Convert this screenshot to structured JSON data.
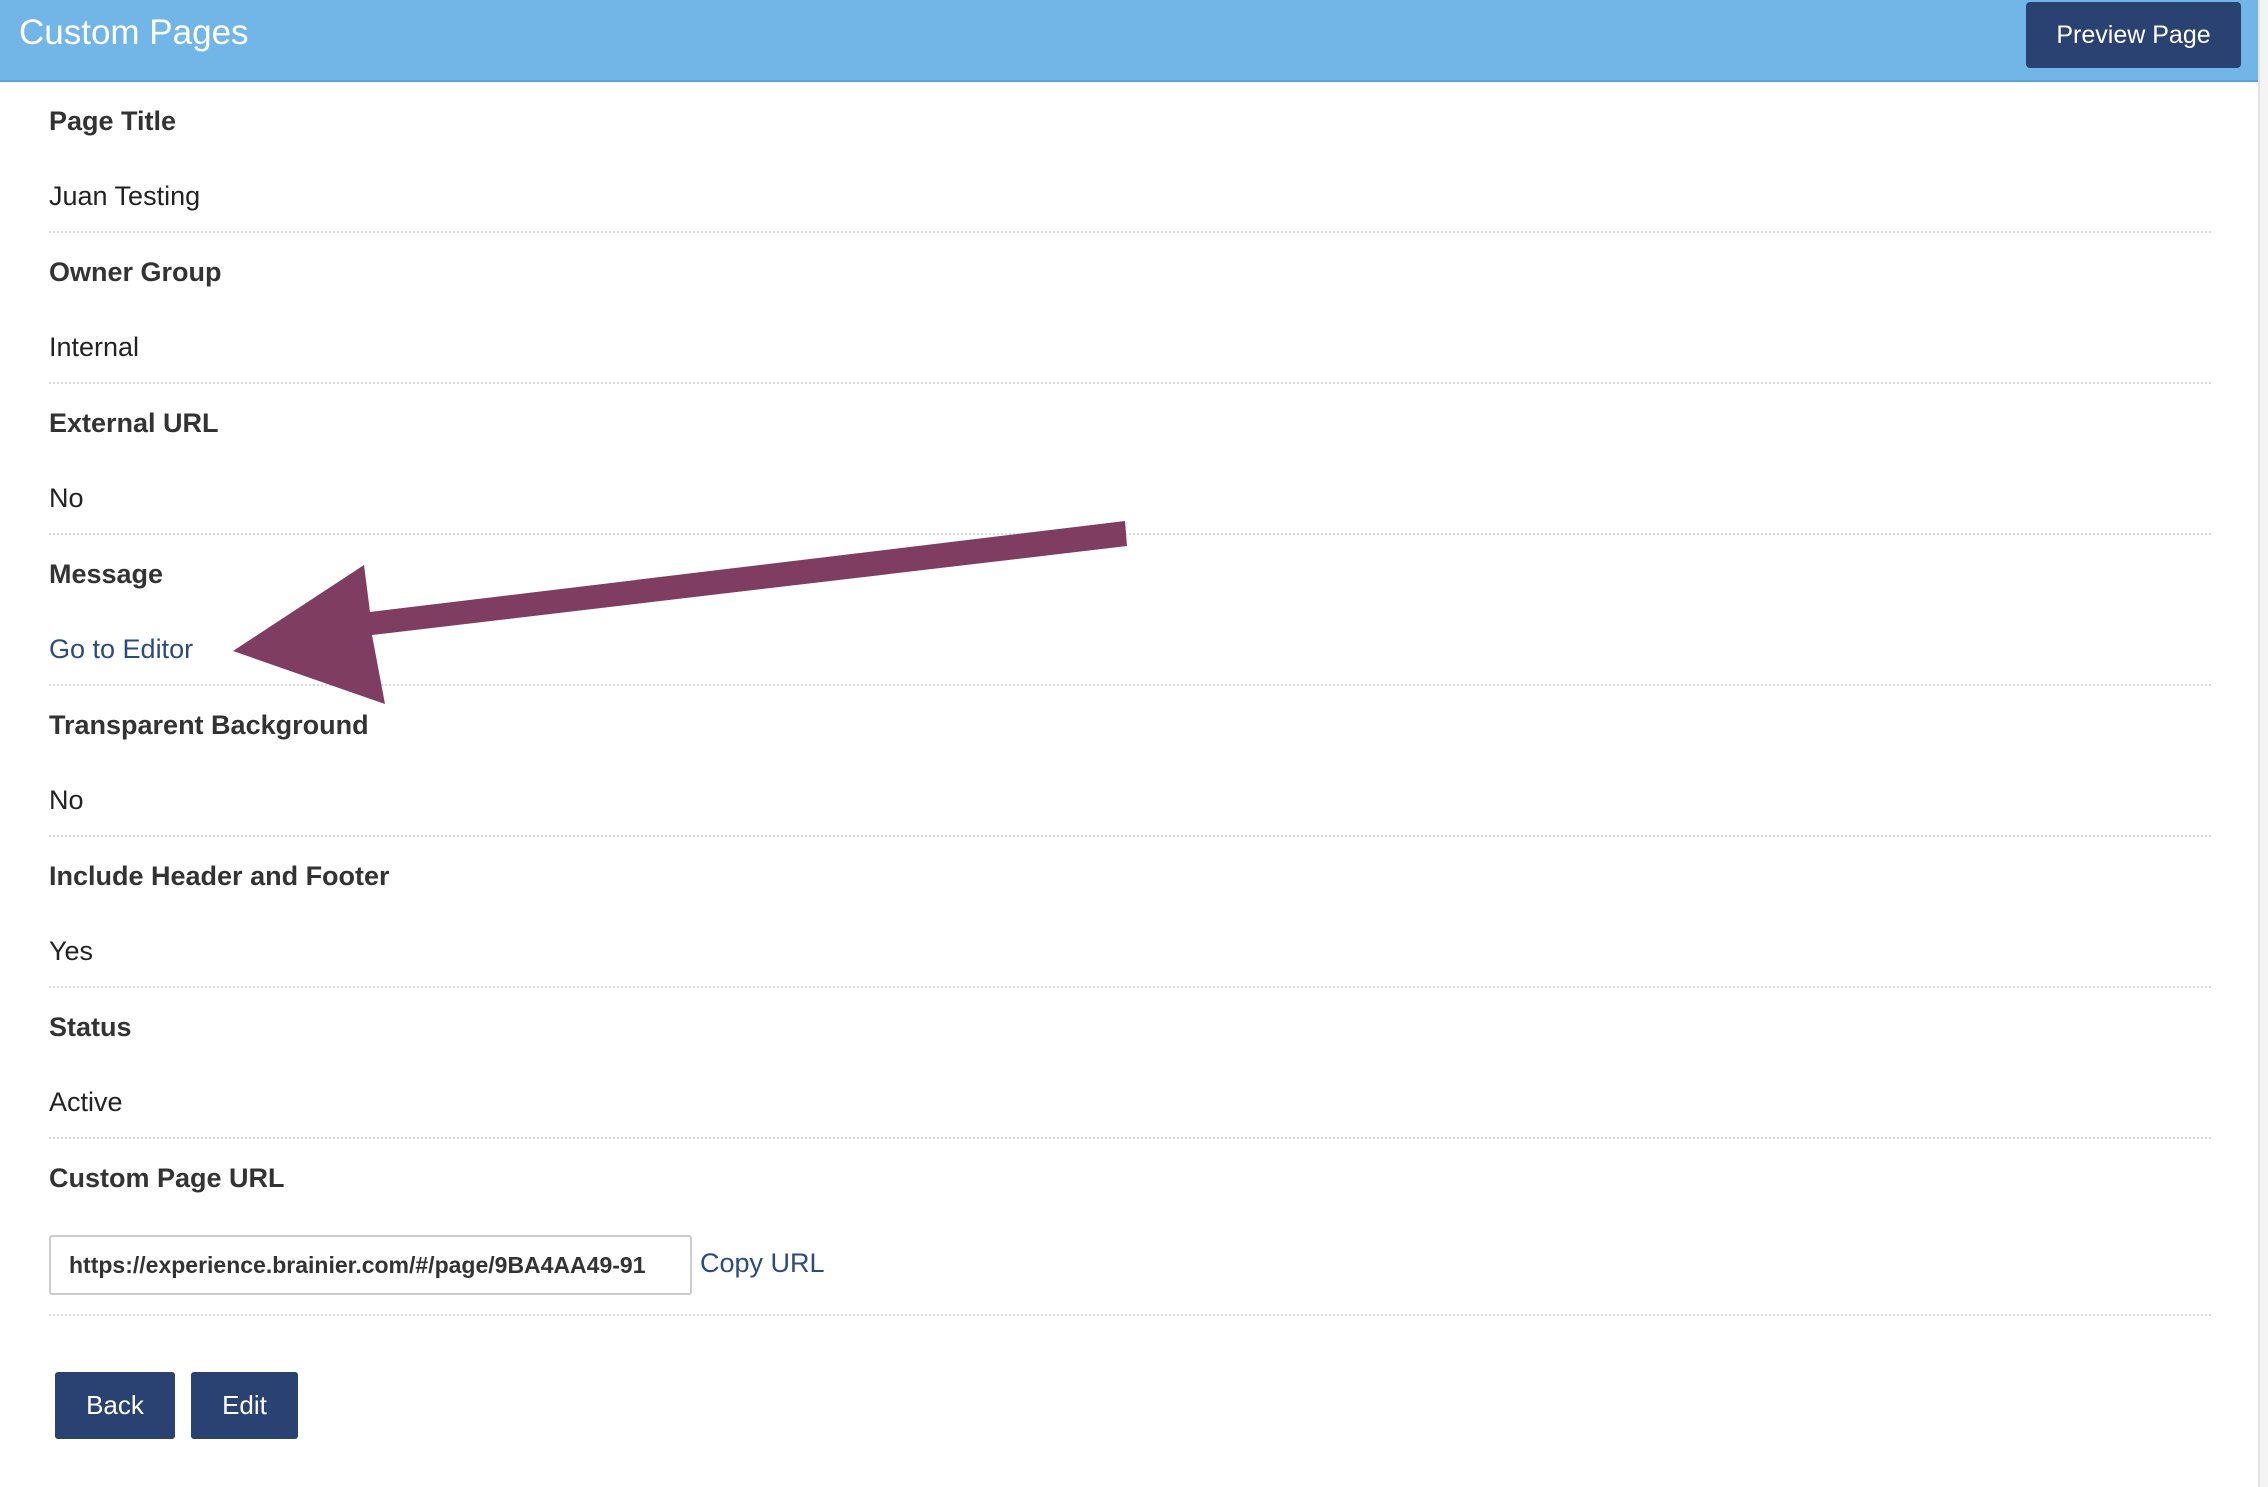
{
  "header": {
    "title": "Custom Pages",
    "preview_label": "Preview Page"
  },
  "fields": [
    {
      "label": "Page Title",
      "value": "Juan Testing"
    },
    {
      "label": "Owner Group",
      "value": "Internal"
    },
    {
      "label": "External URL",
      "value": "No"
    },
    {
      "label": "Message",
      "link": "Go to Editor"
    },
    {
      "label": "Transparent Background",
      "value": "No"
    },
    {
      "label": "Include Header and Footer",
      "value": "Yes"
    },
    {
      "label": "Status",
      "value": "Active"
    }
  ],
  "custom_url": {
    "label": "Custom Page URL",
    "value": "https://experience.brainier.com/#/page/9BA4AA49-91",
    "copy_label": "Copy URL"
  },
  "actions": {
    "back_label": "Back",
    "edit_label": "Edit"
  },
  "colors": {
    "header_bg": "#71b6e6",
    "button_bg": "#2a4272",
    "link": "#2a4a80",
    "annotation_arrow": "#7f3d62"
  },
  "annotation": {
    "icon": "arrow-pointing-left-icon"
  }
}
